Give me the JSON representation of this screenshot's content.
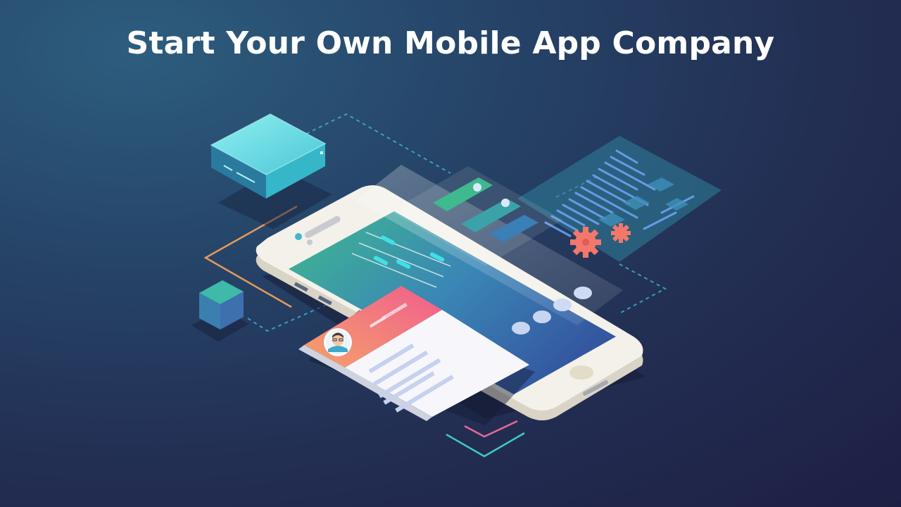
{
  "title": "Start Your Own Mobile App Company",
  "colors": {
    "background_dark": "#1e1f44",
    "background_light": "#2d5d7e",
    "accent_teal": "#3bc4c9",
    "accent_green": "#3fb98e",
    "accent_pink": "#f06b8c",
    "accent_orange": "#f5926b",
    "gear_coral": "#f3776b",
    "phone_body": "#f3f1ea",
    "phone_screen_blue": "#3457a0",
    "code_blue": "#5b8ee8"
  },
  "illustration": {
    "elements": [
      "server-box",
      "small-cube",
      "smartphone",
      "profile-card",
      "code-panel",
      "gears",
      "dashed-connectors"
    ]
  }
}
